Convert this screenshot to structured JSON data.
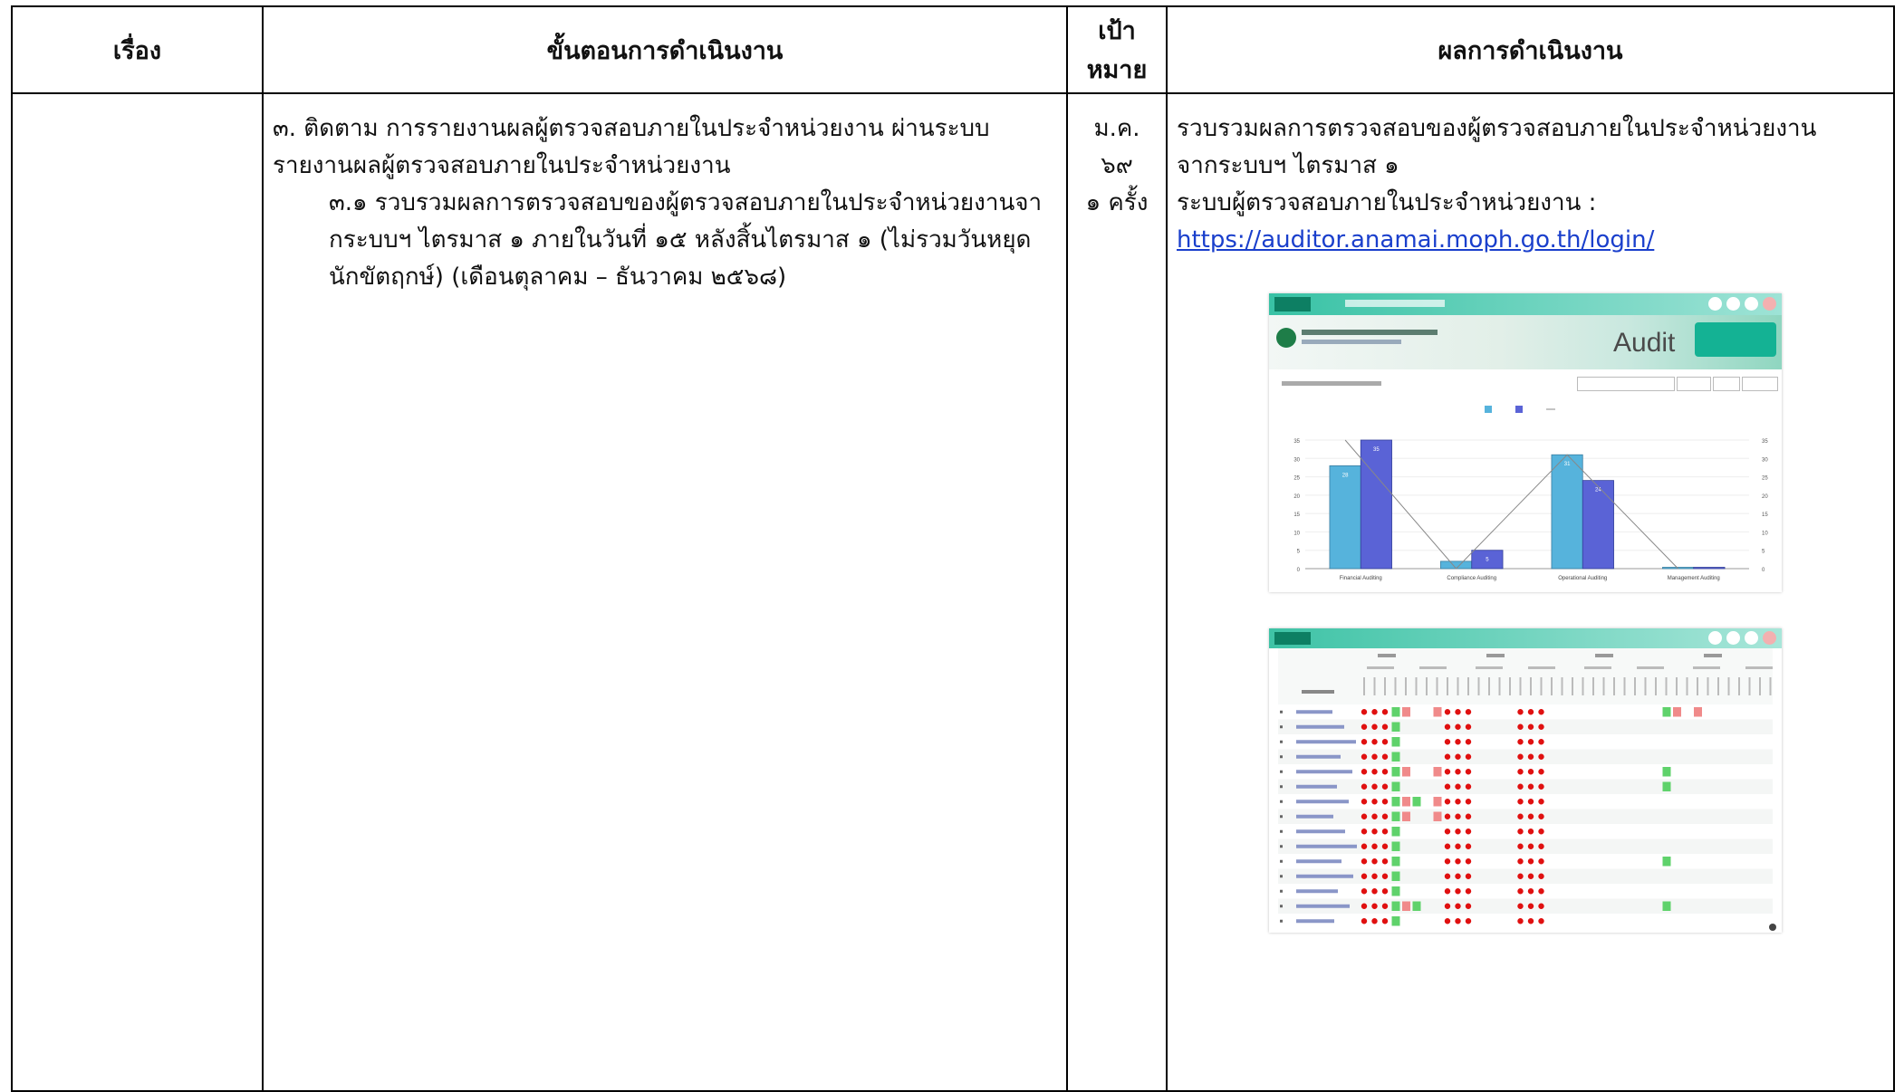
{
  "header": {
    "col_topic": "เรื่อง",
    "col_steps": "ขั้นตอนการดำเนินงาน",
    "col_target": "เป้าหมาย",
    "col_result": "ผลการดำเนินงาน"
  },
  "row": {
    "topic": "",
    "step_line1": "๓. ติดตาม การรายงานผลผู้ตรวจสอบภายในประจำหน่วยงาน ผ่านระบบรายงานผลผู้ตรวจสอบภายในประจำหน่วยงาน",
    "step_sub": "๓.๑ รวบรวมผลการตรวจสอบของผู้ตรวจสอบภายในประจำหน่วยงานจากระบบฯ ไตรมาส ๑ ภายในวันที่ ๑๕ หลังสิ้นไตรมาส ๑ (ไม่รวมวันหยุดนักขัตฤกษ์) (เดือนตุลาคม – ธันวาคม ๒๕๖๘)",
    "target_month": "ม.ค. ๖๙",
    "target_count": "๑ ครั้ง",
    "result_line1": "รวบรวมผลการตรวจสอบของผู้ตรวจสอบภายในประจำหน่วยงาน",
    "result_line2": "จากระบบฯ ไตรมาส ๑",
    "result_line3": "ระบบผู้ตรวจสอบภายในประจำหน่วยงาน :",
    "result_link": "https://auditor.anamai.moph.go.th/login/"
  },
  "screenshot_chart": {
    "banner_word": "Audit",
    "categories": [
      "Financial Auditing",
      "Compliance Auditing",
      "Operational Auditing",
      "Management Auditing"
    ],
    "bar_values_a": [
      28,
      2,
      31,
      0
    ],
    "bar_values_b": [
      35,
      5,
      24,
      0
    ],
    "label_values_a": [
      "28",
      "",
      "31",
      ""
    ],
    "label_values_b": [
      "35",
      "5",
      "24",
      ""
    ],
    "line_values": [
      35,
      0,
      31,
      0
    ],
    "yticks": [
      "0",
      "5",
      "10",
      "15",
      "20",
      "25",
      "30",
      "35"
    ],
    "colors": {
      "a": "#56b3dc",
      "b": "#5a63d6",
      "line": "#888888",
      "topbar": "#38c2a5",
      "banner": "#14b294"
    }
  },
  "screenshot_table": {
    "rows": 15,
    "columns": 40,
    "colors": {
      "dot": "#e01010",
      "green": "#5fd26b",
      "red": "#f08a8a"
    }
  }
}
